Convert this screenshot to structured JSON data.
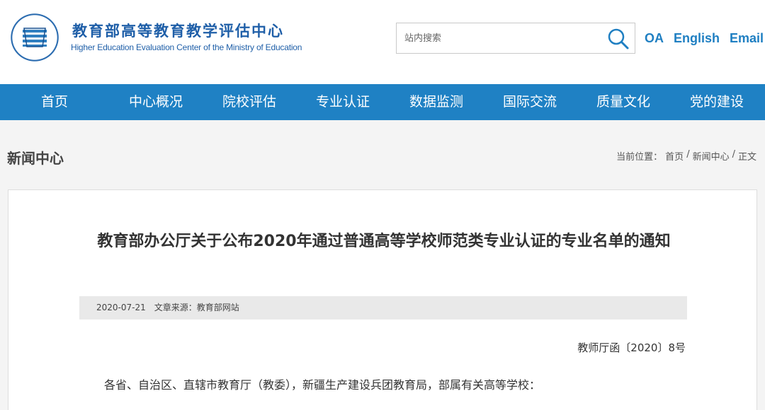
{
  "header": {
    "org_name_cn": "教育部高等教育教学评估中心",
    "org_name_en": "Higher Education Evaluation Center of the Ministry of Education",
    "logo_icon": "heec-seal-logo-icon",
    "search": {
      "placeholder": "站内搜索",
      "value": "",
      "button_icon": "search-icon"
    },
    "links": [
      "OA",
      "English",
      "Email"
    ]
  },
  "nav": {
    "items": [
      "首页",
      "中心概况",
      "院校评估",
      "专业认证",
      "数据监测",
      "国际交流",
      "质量文化",
      "党的建设"
    ]
  },
  "section": {
    "title": "新闻中心",
    "breadcrumb": {
      "prefix": "当前位置：",
      "items": [
        "首页",
        "/",
        "新闻中心",
        "/",
        "正文"
      ]
    }
  },
  "article": {
    "title": "教育部办公厅关于公布2020年通过普通高等学校师范类专业认证的专业名单的通知",
    "date": "2020-07-21",
    "source": "文章来源：教育部网站",
    "doc_number": "教师厅函〔2020〕8号",
    "salutation": "各省、自治区、直辖市教育厅（教委），新疆生产建设兵团教育局，部属有关高等学校："
  },
  "colors": {
    "brand_blue": "#1f5fa8",
    "nav_blue": "#1f81c4",
    "link_blue": "#1f7fc2",
    "band_gray": "#f4f4f4",
    "meta_gray": "#e9e9e9"
  }
}
